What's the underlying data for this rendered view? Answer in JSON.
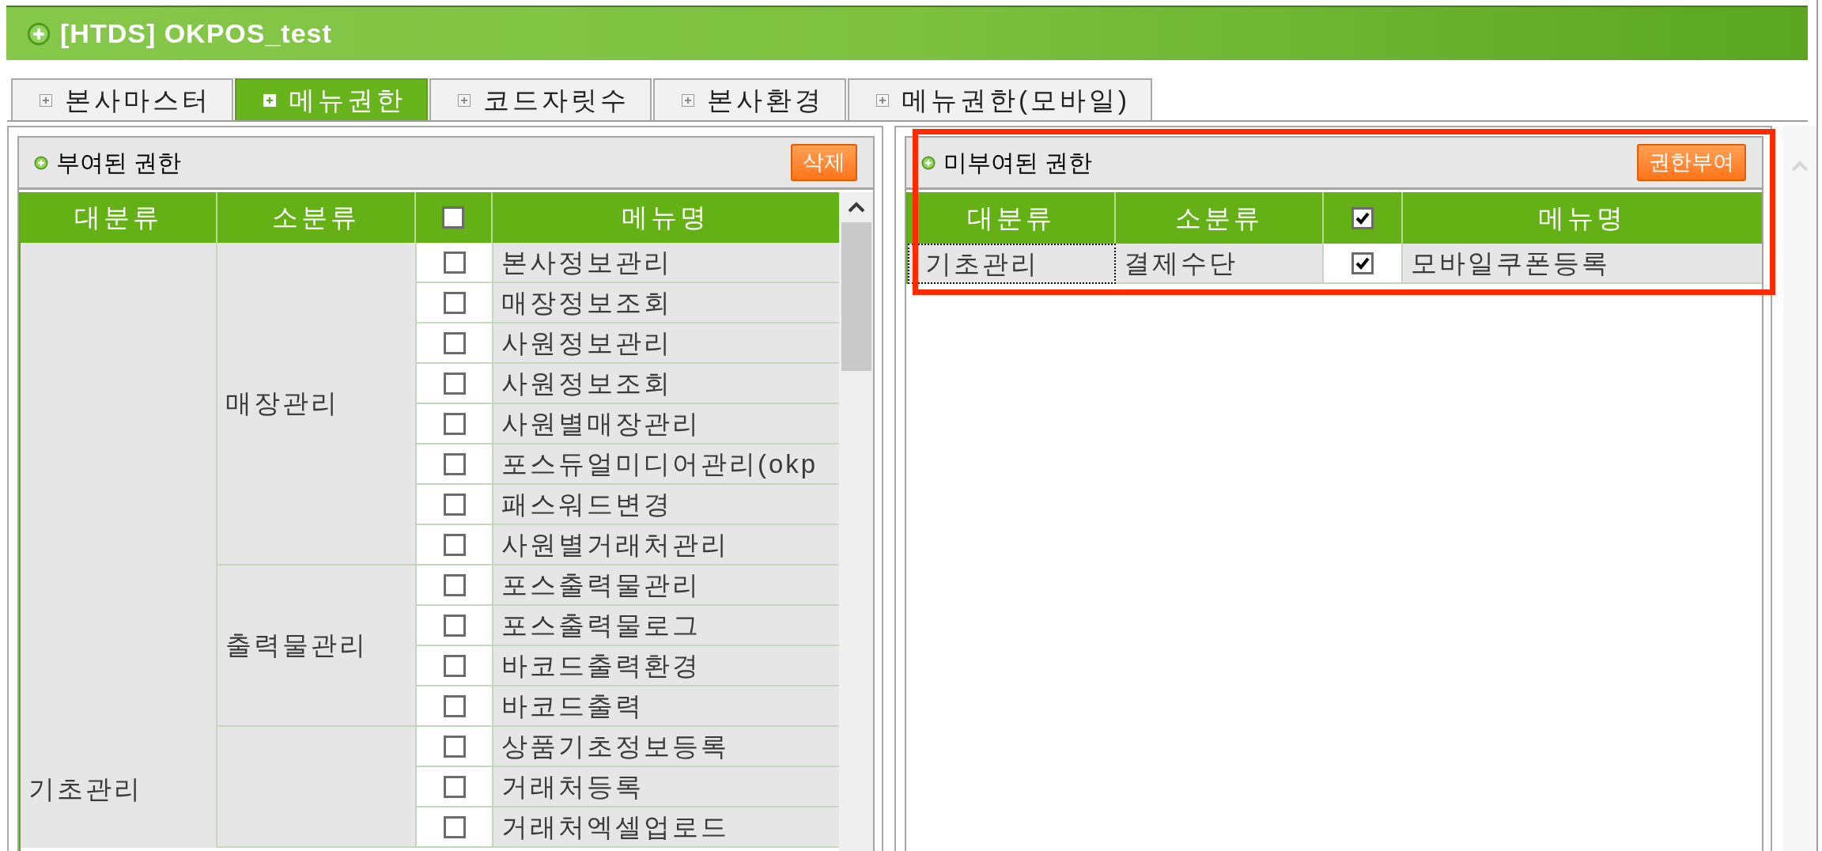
{
  "window": {
    "title": "[HTDS] OKPOS_test"
  },
  "tabs": [
    {
      "label": "본사마스터",
      "selected": false
    },
    {
      "label": "메뉴권한",
      "selected": true
    },
    {
      "label": "코드자릿수",
      "selected": false
    },
    {
      "label": "본사환경",
      "selected": false
    },
    {
      "label": "메뉴권한(모바일)",
      "selected": false
    }
  ],
  "assigned_panel": {
    "title": "부여된 권한",
    "button": "삭제",
    "table": {
      "columns": [
        "대분류",
        "소분류",
        "메뉴명"
      ],
      "select_all_checked": false,
      "groups": [
        {
          "category": "기초관리",
          "subgroups": [
            {
              "name": "매장관리",
              "rows": [
                {
                  "menu": "본사정보관리",
                  "checked": false
                },
                {
                  "menu": "매장정보조회",
                  "checked": false
                },
                {
                  "menu": "사원정보관리",
                  "checked": false
                },
                {
                  "menu": "사원정보조회",
                  "checked": false
                },
                {
                  "menu": "사원별매장관리",
                  "checked": false
                },
                {
                  "menu": "포스듀얼미디어관리(okp",
                  "checked": false
                },
                {
                  "menu": "패스워드변경",
                  "checked": false
                },
                {
                  "menu": "사원별거래처관리",
                  "checked": false
                }
              ]
            },
            {
              "name": "출력물관리",
              "rows": [
                {
                  "menu": "포스출력물관리",
                  "checked": false
                },
                {
                  "menu": "포스출력물로그",
                  "checked": false
                },
                {
                  "menu": "바코드출력환경",
                  "checked": false
                },
                {
                  "menu": "바코드출력",
                  "checked": false
                }
              ]
            },
            {
              "rows": [
                {
                  "menu": "상품기초정보등록",
                  "checked": false
                },
                {
                  "menu": "거래처등록",
                  "checked": false
                },
                {
                  "menu": "거래처엑셀업로드",
                  "checked": false
                }
              ]
            }
          ]
        }
      ]
    }
  },
  "unassigned_panel": {
    "title": "미부여된 권한",
    "button": "권한부여",
    "table": {
      "columns": [
        "대분류",
        "소분류",
        "메뉴명"
      ],
      "select_all_checked": true,
      "rows": [
        {
          "category": "기초관리",
          "subcategory": "결제수단",
          "checked": true,
          "menu": "모바일쿠폰등록",
          "focused": true
        }
      ]
    }
  }
}
